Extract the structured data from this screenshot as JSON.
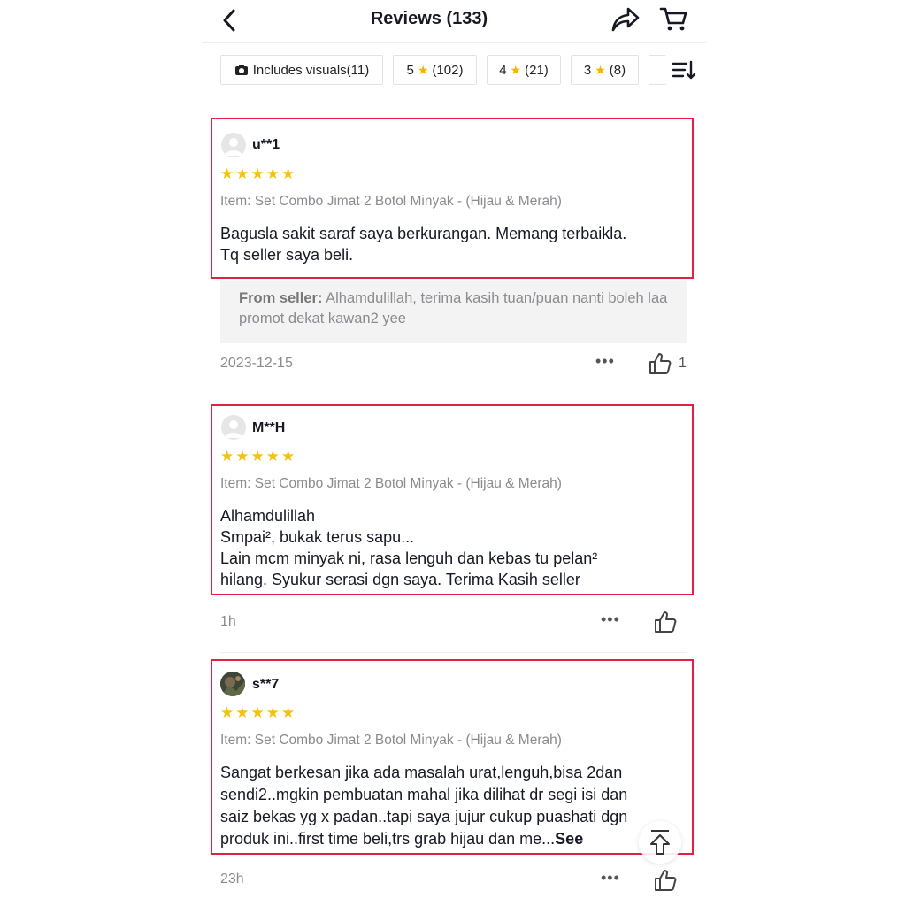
{
  "header": {
    "title": "Reviews (133)"
  },
  "filters": {
    "visuals_label": "Includes visuals(11)",
    "chips": [
      {
        "stars": "5",
        "count": "(102)"
      },
      {
        "stars": "4",
        "count": "(21)"
      },
      {
        "stars": "3",
        "count": "(8)"
      }
    ]
  },
  "reviews": [
    {
      "user": "u**1",
      "rating": 5,
      "stars": "★★★★★",
      "item": "Item: Set Combo Jimat 2 Botol Minyak - (Hijau & Merah)",
      "lines": [
        "Bagusla sakit saraf saya berkurangan. Memang terbaikla.",
        "Tq seller saya beli."
      ],
      "seller_label": "From seller:",
      "seller_reply": "Alhamdulillah, terima kasih tuan/puan nanti boleh laa promot dekat kawan2 yee",
      "date": "2023-12-15",
      "likes": "1"
    },
    {
      "user": "M**H",
      "rating": 5,
      "stars": "★★★★★",
      "item": "Item: Set Combo Jimat 2 Botol Minyak - (Hijau & Merah)",
      "lines": [
        "Alhamdulillah",
        "Smpai², bukak terus sapu...",
        "Lain mcm minyak ni, rasa lenguh dan kebas tu pelan²",
        "hilang. Syukur serasi dgn saya. Terima Kasih seller"
      ],
      "date": "1h"
    },
    {
      "user": "s**7",
      "rating": 5,
      "stars": "★★★★★",
      "item": "Item: Set Combo Jimat 2 Botol Minyak - (Hijau & Merah)",
      "lines": [
        "Sangat berkesan jika ada masalah urat,lenguh,bisa 2dan",
        "sendi2..mgkin pembuatan mahal jika dilihat dr segi isi dan",
        "saiz bekas yg x padan..tapi saya jujur cukup puashati dgn"
      ],
      "last_line": "produk ini..first time beli,trs grab hijau dan me...",
      "see_more": "See",
      "date": "23h"
    }
  ],
  "icons": {
    "back": "back-arrow-icon",
    "share": "share-icon",
    "cart": "cart-icon",
    "camera": "camera-icon",
    "sort": "sort-icon",
    "more": "more-icon",
    "like": "thumbs-up-icon",
    "to_top": "scroll-to-top-icon"
  },
  "colors": {
    "star": "#f4c20d",
    "highlight": "#e0213f",
    "muted": "#8a8b91"
  }
}
